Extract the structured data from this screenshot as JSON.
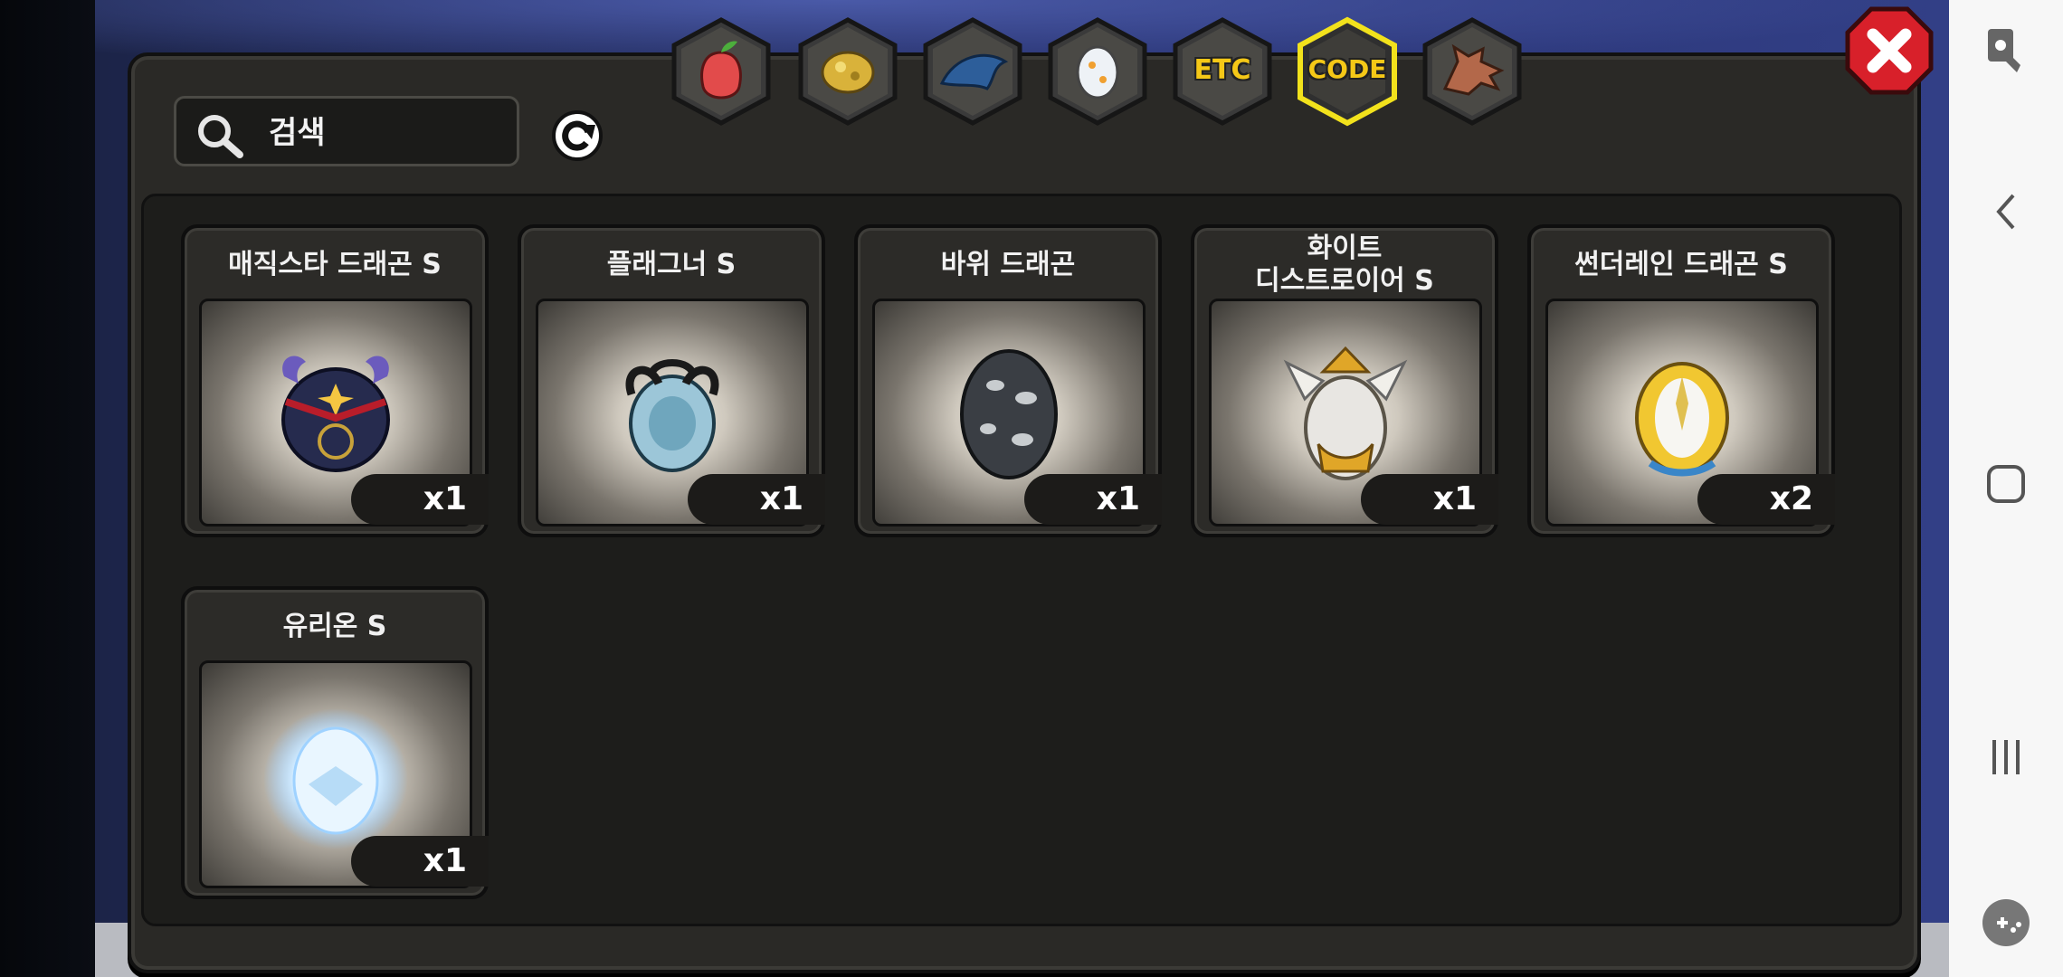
{
  "search": {
    "placeholder": "검색",
    "value": ""
  },
  "tabs": [
    {
      "id": "fruit",
      "icon": "fruit-icon",
      "label": ""
    },
    {
      "id": "gold",
      "icon": "gold-ore-icon",
      "label": ""
    },
    {
      "id": "dragon-scale",
      "icon": "dragon-scale-icon",
      "label": ""
    },
    {
      "id": "egg",
      "icon": "egg-icon",
      "label": ""
    },
    {
      "id": "etc",
      "icon": "",
      "label": "ETC"
    },
    {
      "id": "code",
      "icon": "",
      "label": "CODE",
      "selected": true
    },
    {
      "id": "dragon-head",
      "icon": "dragon-head-icon",
      "label": ""
    }
  ],
  "items": [
    {
      "name": "매직스타 드래곤 S",
      "qty": "x1",
      "icon": "magic-star-dragon-egg-icon"
    },
    {
      "name": "플래그너 S",
      "qty": "x1",
      "icon": "flagner-egg-icon"
    },
    {
      "name": "바위 드래곤",
      "qty": "x1",
      "icon": "rock-dragon-egg-icon"
    },
    {
      "name": "화이트\n디스트로이어 S",
      "qty": "x1",
      "icon": "white-destroyer-egg-icon"
    },
    {
      "name": "썬더레인 드래곤 S",
      "qty": "x2",
      "icon": "thunderrain-dragon-egg-icon"
    },
    {
      "name": "유리온 S",
      "qty": "x1",
      "icon": "yurion-egg-icon"
    }
  ],
  "colors": {
    "selected_tab_border": "#f2e21c",
    "tab_label": "#f5c817",
    "close_red": "#d8202a"
  }
}
